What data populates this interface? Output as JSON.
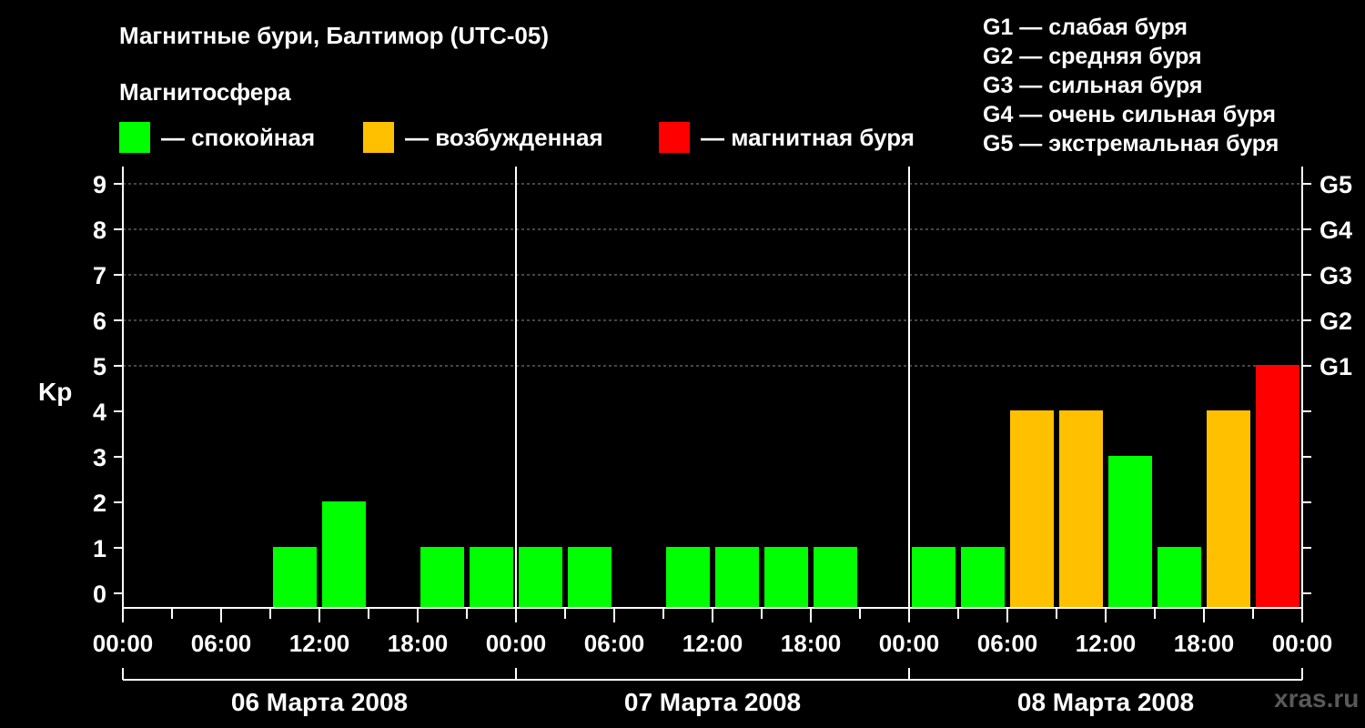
{
  "header": {
    "title": "Магнитные бури, Балтимор (UTC-05)",
    "subtitle": "Магнитосфера"
  },
  "legend": [
    {
      "label": "— спокойная",
      "color": "#00ff00"
    },
    {
      "label": "— возбужденная",
      "color": "#ffc000"
    },
    {
      "label": "— магнитная буря",
      "color": "#ff0000"
    }
  ],
  "storm_levels": [
    "G1 — слабая буря",
    "G2 — средняя буря",
    "G3 — сильная буря",
    "G4 — очень сильная буря",
    "G5 — экстремальная буря"
  ],
  "watermark": "xras.ru",
  "chart_data": {
    "type": "bar",
    "ylabel": "Kp",
    "ylim": [
      0,
      9
    ],
    "yticks": [
      0,
      1,
      2,
      3,
      4,
      5,
      6,
      7,
      8,
      9
    ],
    "right_axis_labels": [
      {
        "kp": 5,
        "label": "G1"
      },
      {
        "kp": 6,
        "label": "G2"
      },
      {
        "kp": 7,
        "label": "G3"
      },
      {
        "kp": 8,
        "label": "G4"
      },
      {
        "kp": 9,
        "label": "G5"
      }
    ],
    "x_tick_labels": [
      "00:00",
      "06:00",
      "12:00",
      "18:00",
      "00:00",
      "06:00",
      "12:00",
      "18:00",
      "00:00",
      "06:00",
      "12:00",
      "18:00",
      "00:00"
    ],
    "days": [
      "06 Марта 2008",
      "07 Марта 2008",
      "08 Марта 2008"
    ],
    "interval_hours": 3,
    "values": [
      0,
      0,
      0,
      1,
      2,
      0,
      1,
      1,
      1,
      1,
      0,
      1,
      1,
      1,
      1,
      0,
      1,
      1,
      4,
      4,
      3,
      1,
      4,
      5
    ],
    "colors": {
      "quiet": "#00ff00",
      "active": "#ffc000",
      "storm": "#ff0000"
    },
    "bar_colors": [
      "quiet",
      "quiet",
      "quiet",
      "quiet",
      "quiet",
      "quiet",
      "quiet",
      "quiet",
      "quiet",
      "quiet",
      "quiet",
      "quiet",
      "quiet",
      "quiet",
      "quiet",
      "quiet",
      "quiet",
      "quiet",
      "active",
      "active",
      "quiet",
      "quiet",
      "active",
      "storm"
    ],
    "grid": "dashed horizontal lines",
    "legend": "top"
  }
}
